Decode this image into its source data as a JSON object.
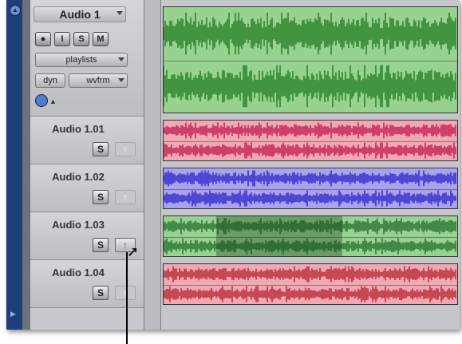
{
  "main_track": {
    "name": "Audio 1",
    "buttons": [
      "●",
      "I",
      "S",
      "M"
    ],
    "playlists_label": "playlists",
    "mode_label": "dyn",
    "view_label": "wvfrm"
  },
  "tracks": [
    {
      "name": "Audio 1.01",
      "solo": "S",
      "input": "↑"
    },
    {
      "name": "Audio 1.02",
      "solo": "S",
      "input": "↑"
    },
    {
      "name": "Audio 1.03",
      "solo": "S",
      "input": "↑"
    },
    {
      "name": "Audio 1.04",
      "solo": "S",
      "input": "↑"
    }
  ],
  "clips": [
    {
      "name": "audio-1-clip",
      "color": "#98d290",
      "wave": "#1f7a1f"
    },
    {
      "name": "audio-1-01-clip",
      "color": "#f0a9b4",
      "wave": "#c0144a"
    },
    {
      "name": "audio-1-02-clip",
      "color": "#a9a3ee",
      "wave": "#2a1ec8"
    },
    {
      "name": "audio-1-03-clip",
      "color": "#98d290",
      "wave": "#1f6a2a"
    },
    {
      "name": "audio-1-04-clip",
      "color": "#f0a9b4",
      "wave": "#b41e2a"
    }
  ],
  "selection": {
    "track": "Audio 1.03",
    "start_fraction": 0.18,
    "end_fraction": 0.61
  },
  "colors": {
    "rail": "#1f3f7a",
    "panel": "#c8c9cc"
  }
}
